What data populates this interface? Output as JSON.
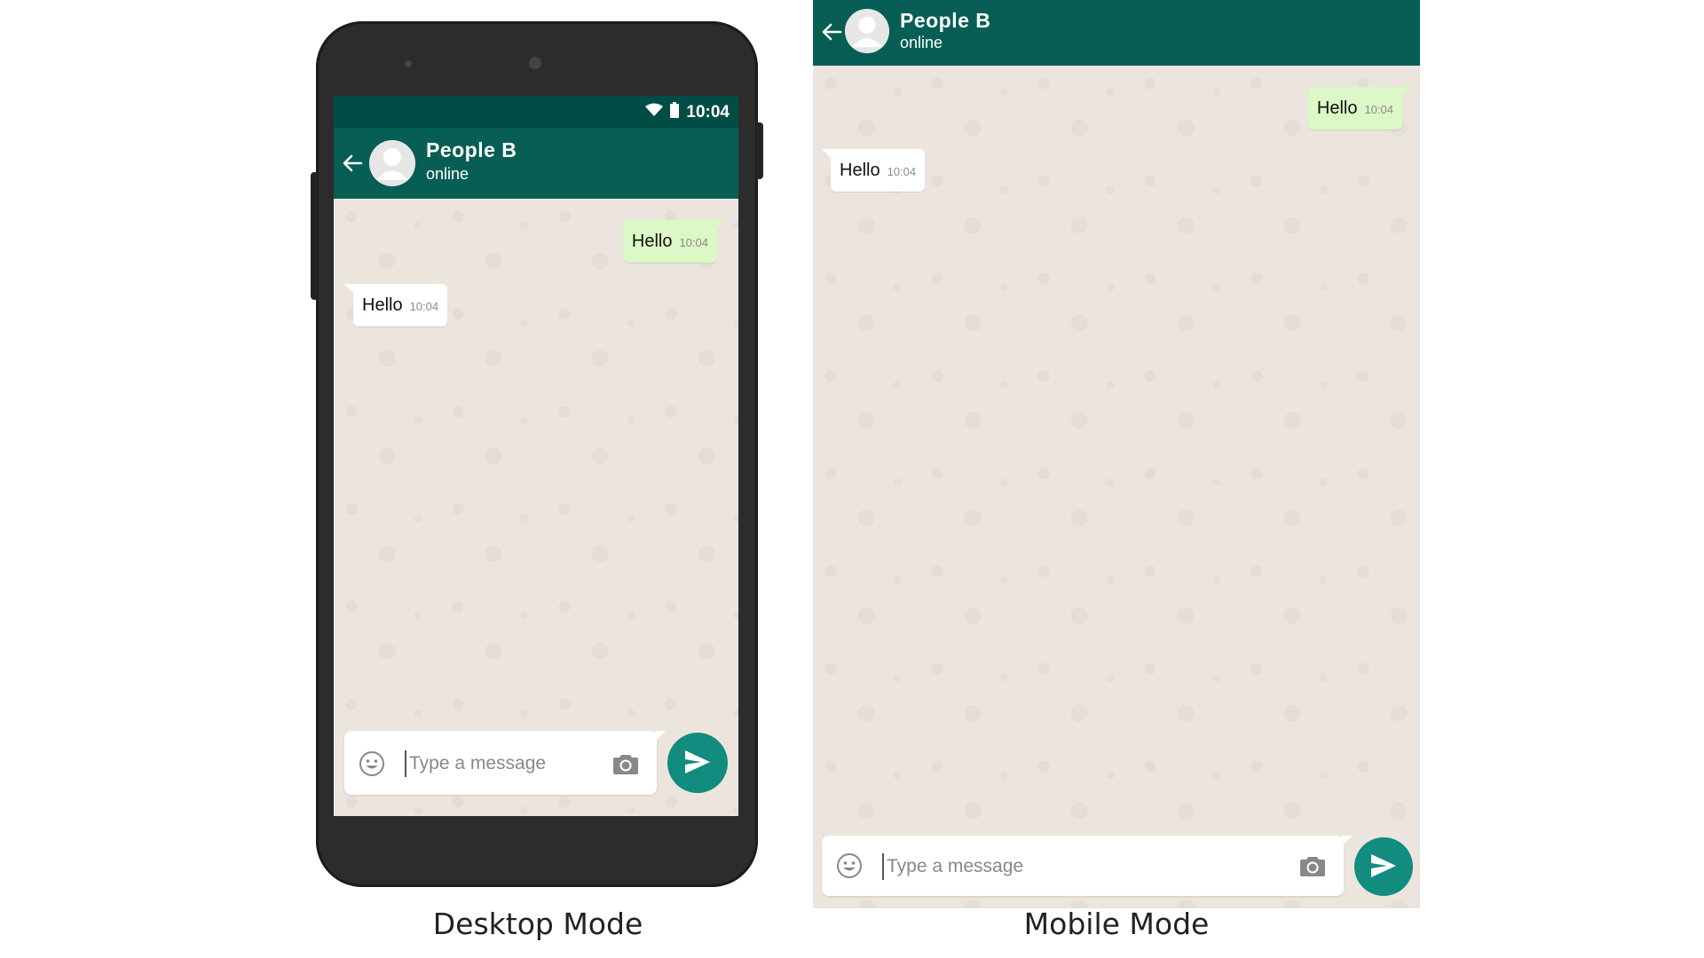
{
  "colors": {
    "header": "#075e54",
    "statusbar": "#004d45",
    "sent_bubble": "#dcf8c6",
    "received_bubble": "#ffffff",
    "chat_background": "#ece5dd",
    "send_button": "#128c7e"
  },
  "captions": {
    "desktop": "Desktop Mode",
    "mobile": "Mobile Mode"
  },
  "desktop": {
    "statusbar": {
      "time": "10:04",
      "icons": [
        "wifi-icon",
        "battery-icon"
      ]
    },
    "header": {
      "contact_name": "People B",
      "contact_status": "online",
      "icons": [
        "back-arrow-icon",
        "avatar"
      ]
    },
    "messages": [
      {
        "direction": "sent",
        "text": "Hello",
        "time": "10:04"
      },
      {
        "direction": "received",
        "text": "Hello",
        "time": "10:04"
      }
    ],
    "composer": {
      "placeholder": "Type a message",
      "icons": [
        "emoji-icon",
        "camera-icon",
        "send-icon"
      ]
    }
  },
  "mobile": {
    "header": {
      "contact_name": "People B",
      "contact_status": "online",
      "icons": [
        "back-arrow-icon",
        "avatar"
      ]
    },
    "messages": [
      {
        "direction": "sent",
        "text": "Hello",
        "time": "10:04"
      },
      {
        "direction": "received",
        "text": "Hello",
        "time": "10:04"
      }
    ],
    "composer": {
      "placeholder": "Type a message",
      "icons": [
        "emoji-icon",
        "camera-icon",
        "send-icon"
      ]
    }
  }
}
